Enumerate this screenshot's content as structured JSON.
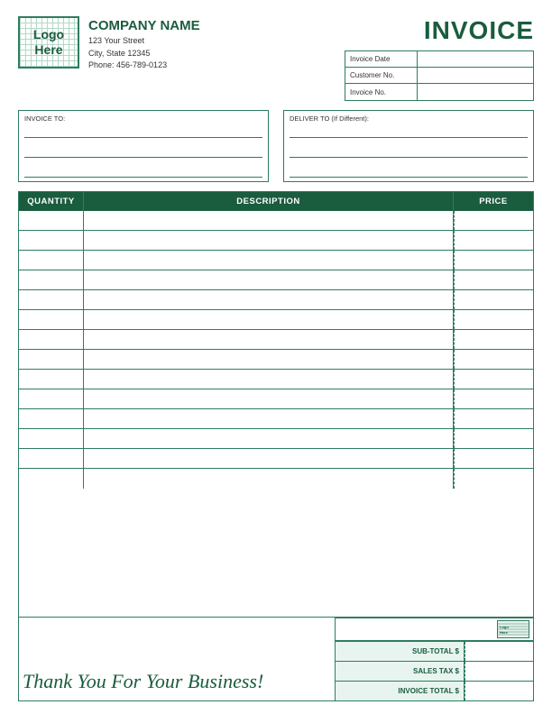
{
  "header": {
    "logo": {
      "line1": "Logo",
      "line2": "Here"
    },
    "company": {
      "name": "COMPANY NAME",
      "street": "123 Your Street",
      "city_state": "City, State 12345",
      "phone": "Phone: 456-789-0123"
    },
    "invoice_title": "INVOICE",
    "fields": [
      {
        "label": "Invoice Date",
        "value": ""
      },
      {
        "label": "Customer No.",
        "value": ""
      },
      {
        "label": "Invoice No.",
        "value": ""
      }
    ]
  },
  "address": {
    "invoice_to_label": "INVOICE TO:",
    "deliver_to_label": "DELIVER TO (If Different):"
  },
  "table": {
    "col_qty": "QUANTITY",
    "col_desc": "DESCRIPTION",
    "col_price": "PRICE",
    "rows": 14
  },
  "footer": {
    "thank_you": "Thank You For Your Business!",
    "subtotal_label": "SUB-TOTAL $",
    "sales_tax_label": "SALES TAX $",
    "invoice_total_label": "INVOICE TOTAL $"
  }
}
